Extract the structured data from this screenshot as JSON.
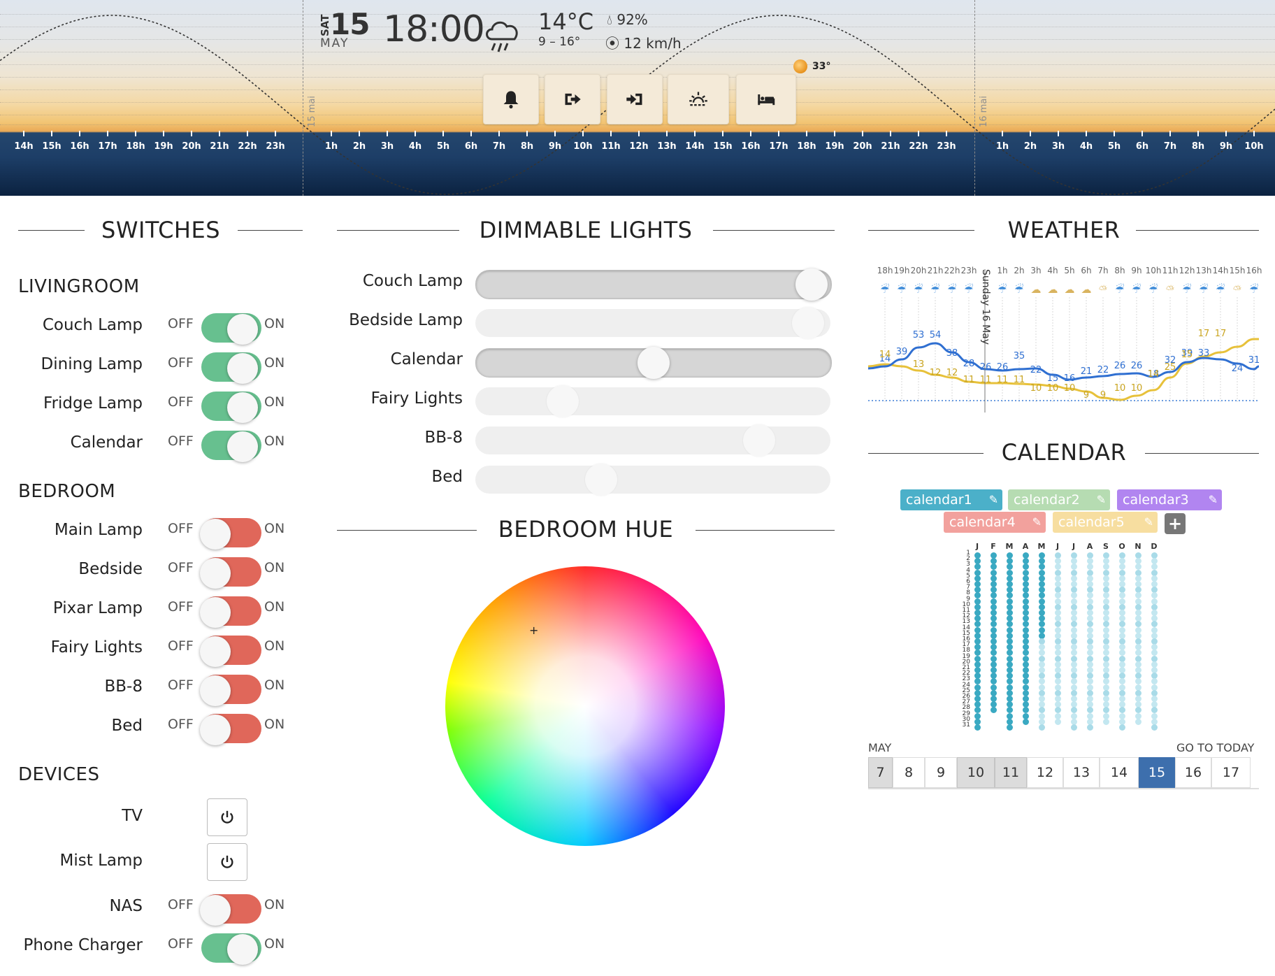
{
  "header": {
    "weekday": "SAT",
    "day": "15",
    "month": "MAY",
    "time": "18:00",
    "temperature": "14°C",
    "temp_range": "9 – 16°",
    "humidity": "92%",
    "wind": "12 km/h",
    "sun_temp": "33°",
    "weather_icon": "rain-cloud-icon",
    "day_labels": [
      "15 mai",
      "16 mai"
    ],
    "hours_row": [
      "h",
      "14h",
      "15h",
      "16h",
      "17h",
      "18h",
      "19h",
      "20h",
      "21h",
      "22h",
      "23h",
      "1h",
      "2h",
      "3h",
      "4h",
      "5h",
      "6h",
      "7h",
      "8h",
      "9h",
      "10h",
      "11h",
      "12h",
      "13h",
      "14h",
      "15h",
      "16h",
      "17h",
      "18h",
      "19h",
      "20h",
      "21h",
      "22h",
      "23h",
      "1h",
      "2h",
      "3h",
      "4h",
      "5h",
      "6h",
      "7h",
      "8h",
      "9h",
      "10h"
    ],
    "quick_buttons": [
      "bell-icon",
      "leave-home-icon",
      "arrive-home-icon",
      "sunrise-icon",
      "bed-icon"
    ]
  },
  "switches": {
    "title": "SWITCHES",
    "groups": [
      {
        "name": "LIVINGROOM",
        "items": [
          {
            "label": "Couch Lamp",
            "state": "on"
          },
          {
            "label": "Dining Lamp",
            "state": "on"
          },
          {
            "label": "Fridge Lamp",
            "state": "on"
          },
          {
            "label": "Calendar",
            "state": "on"
          }
        ]
      },
      {
        "name": "BEDROOM",
        "items": [
          {
            "label": "Main Lamp",
            "state": "off"
          },
          {
            "label": "Bedside",
            "state": "off"
          },
          {
            "label": "Pixar Lamp",
            "state": "off"
          },
          {
            "label": "Fairy Lights",
            "state": "off"
          },
          {
            "label": "BB-8",
            "state": "off"
          },
          {
            "label": "Bed",
            "state": "off"
          }
        ]
      },
      {
        "name": "DEVICES",
        "items": [
          {
            "label": "TV",
            "type": "power"
          },
          {
            "label": "Mist Lamp",
            "type": "power"
          },
          {
            "label": "NAS",
            "state": "off"
          },
          {
            "label": "Phone Charger",
            "state": "on"
          }
        ]
      }
    ],
    "off_label": "OFF",
    "on_label": "ON"
  },
  "dimmable": {
    "title": "DIMMABLE LIGHTS",
    "lights": [
      {
        "label": "Couch Lamp",
        "level": 0.99,
        "active": true
      },
      {
        "label": "Bedside Lamp",
        "level": 0.98,
        "active": false
      },
      {
        "label": "Calendar",
        "level": 0.5,
        "active": true
      },
      {
        "label": "Fairy Lights",
        "level": 0.22,
        "active": false
      },
      {
        "label": "BB-8",
        "level": 0.83,
        "active": false
      },
      {
        "label": "Bed",
        "level": 0.34,
        "active": false
      }
    ]
  },
  "hue": {
    "title": "BEDROOM HUE"
  },
  "weather": {
    "title": "WEATHER",
    "day_marker": "Sunday 16 May",
    "hours": [
      "18h",
      "19h",
      "20h",
      "21h",
      "22h",
      "23h",
      "1h",
      "2h",
      "3h",
      "4h",
      "5h",
      "6h",
      "7h",
      "8h",
      "9h",
      "10h",
      "11h",
      "12h",
      "13h",
      "14h",
      "15h",
      "16h"
    ],
    "icons": [
      "rain",
      "rain",
      "rain",
      "rain",
      "rain",
      "rain",
      "rain",
      "rain",
      "cloud",
      "cloud",
      "cloud",
      "cloud",
      "sun-cloud",
      "rain",
      "rain",
      "rain",
      "sun-cloud",
      "rain",
      "rain",
      "rain",
      "sun-cloud",
      "rain"
    ],
    "series_blue_labels": [
      "14",
      "39",
      "53",
      "54",
      "38",
      "28",
      "26",
      "26",
      "35",
      "22",
      "15",
      "16",
      "21",
      "22",
      "26",
      "26",
      "18",
      "32",
      "39",
      "33",
      "24",
      "31"
    ],
    "series_yellow_labels": [
      "14",
      "13",
      "12",
      "12",
      "11",
      "11",
      "11",
      "11",
      "10",
      "10",
      "10",
      "9",
      "9",
      "10",
      "10",
      "14",
      "25",
      "15",
      "17",
      "17"
    ],
    "colors": {
      "blue": "#2f6fd1",
      "yellow": "#e7c13a"
    }
  },
  "calendar": {
    "title": "CALENDAR",
    "tags": [
      {
        "label": "calendar1",
        "color": "#4bb0c9"
      },
      {
        "label": "calendar2",
        "color": "#b6dcb2"
      },
      {
        "label": "calendar3",
        "color": "#b185f0"
      },
      {
        "label": "calendar4",
        "color": "#f2a19d"
      },
      {
        "label": "calendar5",
        "color": "#f7dea0"
      }
    ],
    "add_label": "+",
    "months": [
      "J",
      "F",
      "M",
      "A",
      "M",
      "J",
      "J",
      "A",
      "S",
      "O",
      "N",
      "D"
    ],
    "days": [
      "1",
      "2",
      "3",
      "4",
      "5",
      "6",
      "7",
      "8",
      "9",
      "10",
      "11",
      "12",
      "13",
      "14",
      "15",
      "16",
      "17",
      "18",
      "19",
      "20",
      "21",
      "22",
      "23",
      "24",
      "25",
      "26",
      "27",
      "28",
      "29",
      "30",
      "31"
    ],
    "month_label": "MAY",
    "goto_today": "GO TO TODAY",
    "strip_days": [
      "7",
      "8",
      "9",
      "10",
      "11",
      "12",
      "13",
      "14",
      "15",
      "16",
      "17"
    ],
    "today": "15",
    "grey_days": [
      "7",
      "10",
      "11"
    ]
  }
}
